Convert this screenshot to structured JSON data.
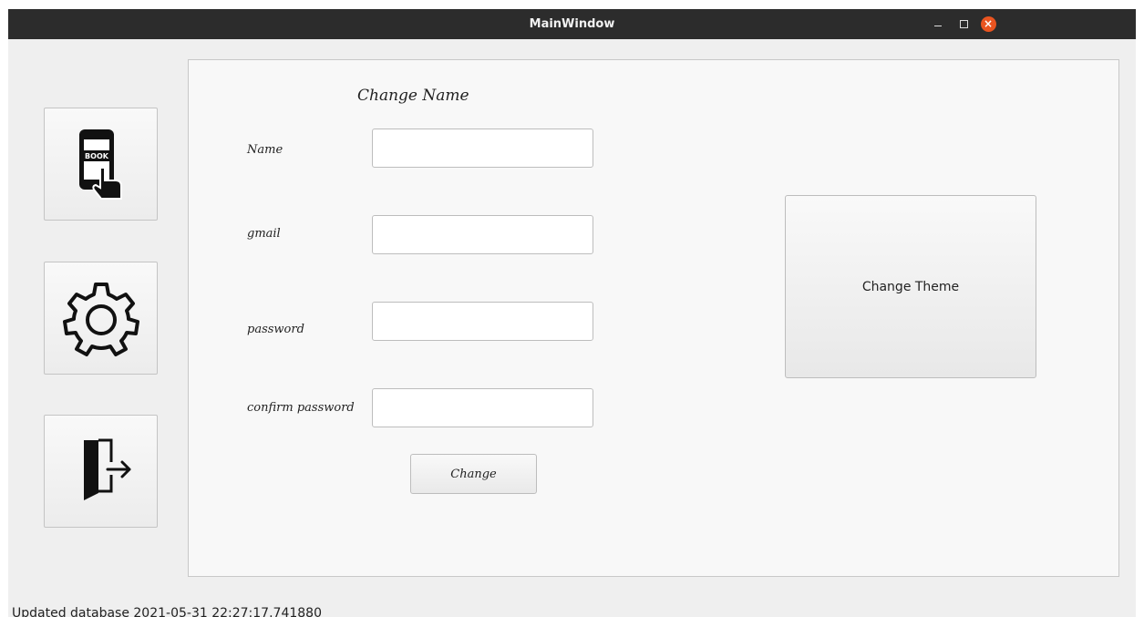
{
  "window": {
    "title": "MainWindow",
    "controls": {
      "minimize": "–",
      "maximize": "□",
      "close": "×"
    }
  },
  "sidebar": {
    "items": [
      {
        "name": "book",
        "icon": "book-tap-icon",
        "icon_text": "BOOK"
      },
      {
        "name": "settings",
        "icon": "gear-icon"
      },
      {
        "name": "logout",
        "icon": "exit-door-icon"
      }
    ]
  },
  "form": {
    "heading": "Change Name",
    "fields": [
      {
        "label": "Name",
        "value": ""
      },
      {
        "label": "gmail",
        "value": ""
      },
      {
        "label": "password",
        "value": ""
      },
      {
        "label": "confirm password",
        "value": ""
      }
    ],
    "submit_label": "Change"
  },
  "theme_button_label": "Change Theme",
  "status_bar": {
    "text": "Updated database 2021-05-31 22:27:17.741880"
  },
  "colors": {
    "titlebar": "#2c2c2c",
    "close_button": "#e95420",
    "window_bg": "#efefef",
    "panel_bg": "#f8f8f8"
  }
}
